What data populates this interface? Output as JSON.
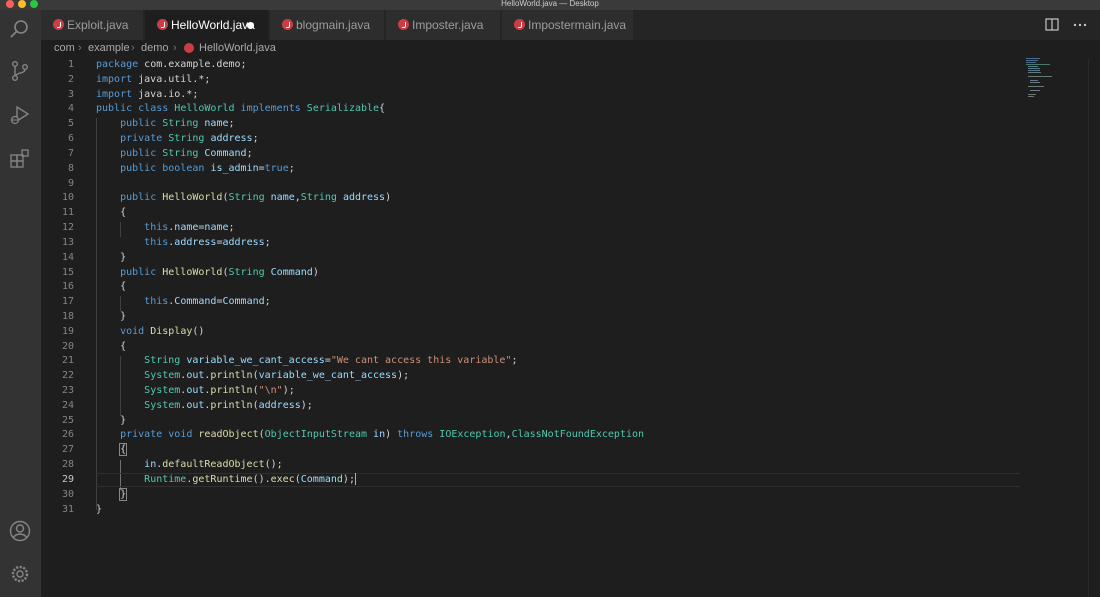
{
  "window": {
    "title": "HelloWorld.java — Desktop"
  },
  "tabs": [
    {
      "label": "Exploit.java",
      "active": false,
      "modified": false
    },
    {
      "label": "HelloWorld.java",
      "active": true,
      "modified": true
    },
    {
      "label": "blogmain.java",
      "active": false,
      "modified": false
    },
    {
      "label": "Imposter.java",
      "active": false,
      "modified": false
    },
    {
      "label": "Impostermain.java",
      "active": false,
      "modified": false
    }
  ],
  "breadcrumb": {
    "items": [
      "com",
      "example",
      "demo",
      "HelloWorld.java"
    ]
  },
  "editor": {
    "current_line": 29,
    "line_numbers": [
      "1",
      "2",
      "3",
      "4",
      "5",
      "6",
      "7",
      "8",
      "9",
      "10",
      "11",
      "12",
      "13",
      "14",
      "15",
      "16",
      "17",
      "18",
      "19",
      "20",
      "21",
      "22",
      "23",
      "24",
      "25",
      "26",
      "27",
      "28",
      "29",
      "30",
      "31"
    ]
  },
  "icons": {
    "activity_bar": [
      "search-icon",
      "source-control-icon",
      "run-debug-icon",
      "extensions-icon",
      "account-icon",
      "settings-gear-icon"
    ],
    "tab_actions": [
      "split-editor-icon",
      "more-actions-icon"
    ]
  },
  "colors": {
    "keyword": "#569cd6",
    "type": "#4ec9b0",
    "function": "#dcdcaa",
    "variable": "#9cdcfe",
    "string": "#ce9178",
    "java_icon": "#cc3e44"
  }
}
